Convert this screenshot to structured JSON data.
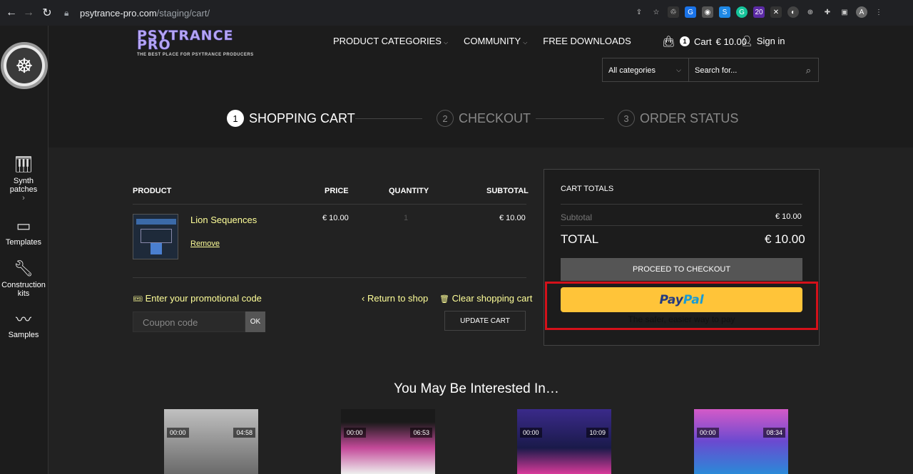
{
  "browser": {
    "url_domain": "psytrance-pro.com",
    "url_path": "/staging/cart/",
    "extension_badge": "20",
    "profile_initial": "A"
  },
  "brand": {
    "name_line1": "PSYTRANCE",
    "name_line2": "PRO",
    "tagline": "THE BEST PLACE FOR PSYTRANCE PRODUCERS"
  },
  "sidebar": {
    "items": [
      {
        "label": "Synth patches",
        "arrow": "›"
      },
      {
        "label": "Templates"
      },
      {
        "label": "Construction kits"
      },
      {
        "label": "Samples"
      }
    ]
  },
  "nav": {
    "items": [
      {
        "label": "PRODUCT CATEGORIES",
        "caret": "⌵"
      },
      {
        "label": "COMMUNITY",
        "caret": "⌵"
      },
      {
        "label": "FREE DOWNLOADS"
      }
    ],
    "cart_count": "1",
    "cart_label": "Cart",
    "cart_total": "€ 10.00",
    "signin_label": "Sign in"
  },
  "search": {
    "category": "All categories",
    "placeholder": "Search for..."
  },
  "steps": [
    {
      "num": "1",
      "label": "SHOPPING CART"
    },
    {
      "num": "2",
      "label": "CHECKOUT"
    },
    {
      "num": "3",
      "label": "ORDER STATUS"
    }
  ],
  "cart": {
    "headers": {
      "product": "PRODUCT",
      "price": "PRICE",
      "quantity": "QUANTITY",
      "subtotal": "SUBTOTAL"
    },
    "items": [
      {
        "name": "Lion Sequences",
        "remove": "Remove",
        "price": "€ 10.00",
        "quantity": "1",
        "subtotal": "€ 10.00"
      }
    ],
    "promo_label": "Enter your promotional code",
    "coupon_placeholder": "Coupon code",
    "ok_label": "OK",
    "return_label": "Return to shop",
    "clear_label": "Clear shopping cart",
    "update_label": "UPDATE CART"
  },
  "totals": {
    "title": "CART TOTALS",
    "subtotal_label": "Subtotal",
    "subtotal_value": "€ 10.00",
    "total_label": "TOTAL",
    "total_value": "€ 10.00",
    "proceed_label": "PROCEED TO CHECKOUT",
    "paypal_pay": "Pay",
    "paypal_pal": "Pal",
    "paypal_tagline": "The safer, easier way to pay"
  },
  "interested": {
    "title": "You May Be Interested In…",
    "cards": [
      {
        "start": "00:00",
        "duration": "04:58",
        "color": "#8a8a8a"
      },
      {
        "start": "00:00",
        "duration": "06:53",
        "color": "#c44a9a"
      },
      {
        "start": "00:00",
        "duration": "10:09",
        "color": "#3a2a8a"
      },
      {
        "start": "00:00",
        "duration": "08:34",
        "color": "#6a4ad0"
      }
    ]
  },
  "colors": {
    "accent_link": "#ffff99",
    "paypal_yellow": "#ffc439",
    "highlight_red": "#d4111a"
  }
}
